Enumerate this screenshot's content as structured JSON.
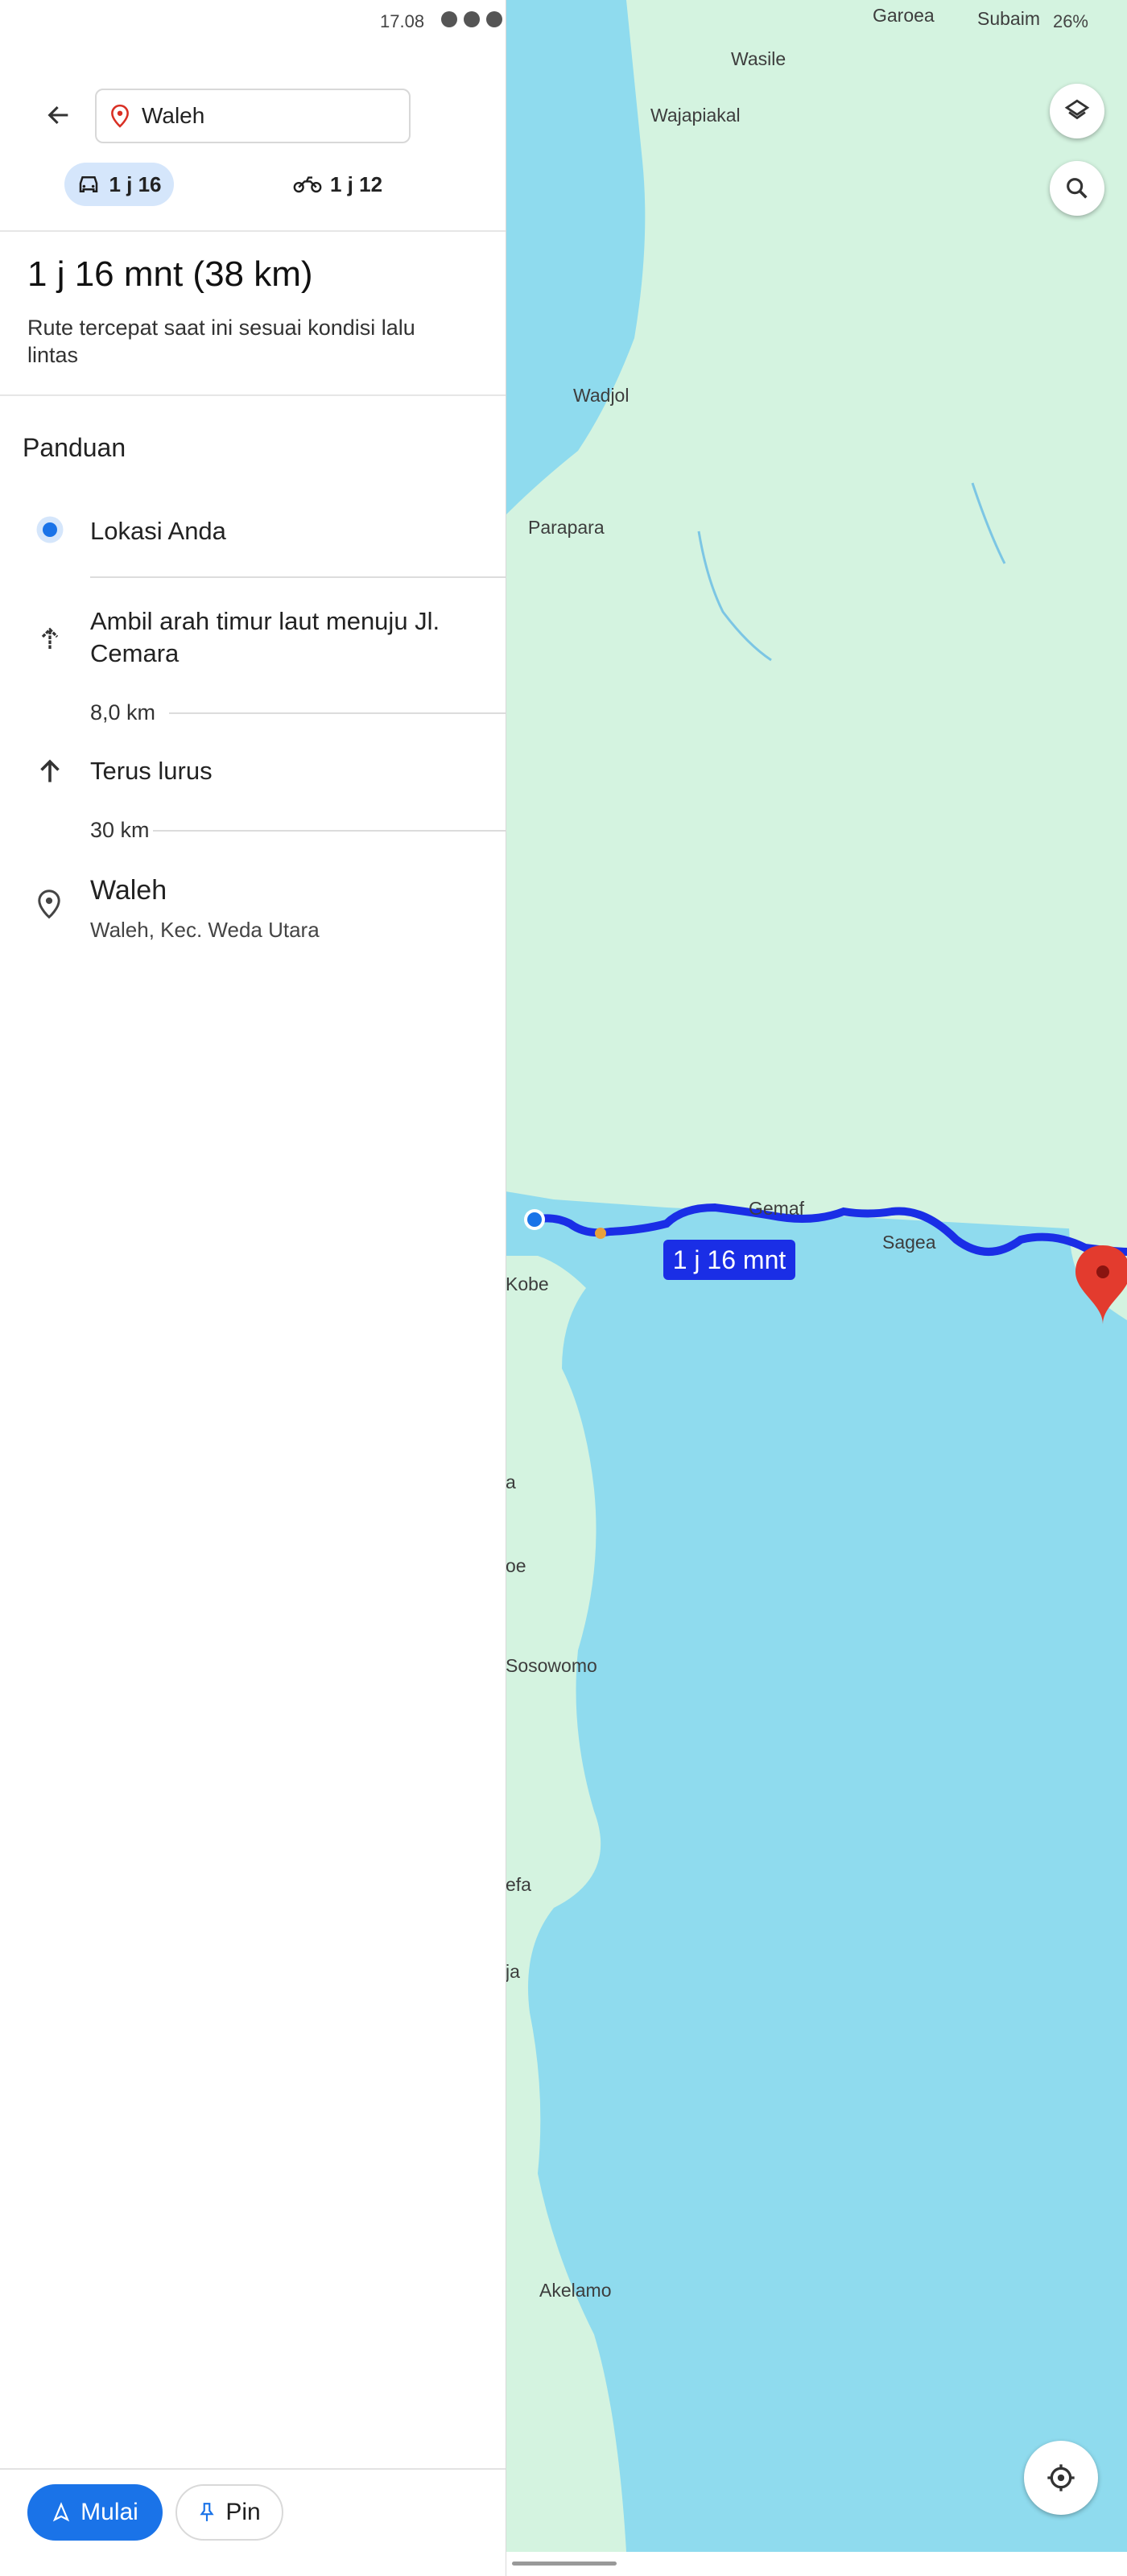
{
  "status_bar": {
    "time": "17.08",
    "battery": "26%"
  },
  "search": {
    "destination": "Waleh"
  },
  "travel_modes": [
    {
      "icon": "car-icon",
      "label": "1 j 16",
      "selected": true
    },
    {
      "icon": "motorcycle-icon",
      "label": "1 j 12",
      "selected": false
    }
  ],
  "route": {
    "summary": "1 j 16 mnt (38 km)",
    "description": "Rute tercepat saat ini sesuai kondisi lalu lintas"
  },
  "directions": {
    "title": "Panduan",
    "origin": "Lokasi Anda",
    "steps": [
      {
        "icon": "northeast-arrow-icon",
        "text": "Ambil arah timur laut menuju Jl. Cemara",
        "distance": "8,0 km"
      },
      {
        "icon": "straight-arrow-icon",
        "text": "Terus lurus",
        "distance": "30 km"
      }
    ],
    "destination": {
      "name": "Waleh",
      "address": "Waleh, Kec. Weda Utara"
    }
  },
  "buttons": {
    "start": "Mulai",
    "pin": "Pin"
  },
  "map": {
    "route_label": "1 j 16 mnt",
    "places": [
      "Garoea",
      "Subaim",
      "Wasile",
      "Wajapiakal",
      "Wadjol",
      "Parapara",
      "Gemaf",
      "Sagea",
      "Kobe",
      "Sosowomo",
      "Akelamo",
      "a",
      "oe",
      "efa",
      "ja"
    ],
    "colors": {
      "water": "#8fdbee",
      "land": "#d4f3e0",
      "route": "#1a2ee6",
      "start": "#1a73e8"
    }
  }
}
